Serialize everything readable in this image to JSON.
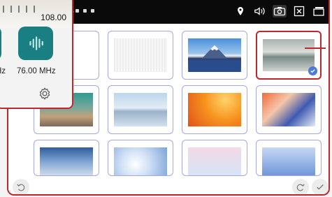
{
  "status": {
    "num": "4"
  },
  "popup": {
    "top_freq": "108.00",
    "main_freq": "76.00 MHz",
    "left_freq_fragment": "Hz"
  },
  "wallpapers": [
    {
      "name": "white"
    },
    {
      "name": "gray-texture"
    },
    {
      "name": "mount-fuji"
    },
    {
      "name": "misty-lake"
    },
    {
      "name": "desert-sunset"
    },
    {
      "name": "salt-flats"
    },
    {
      "name": "orange-waves"
    },
    {
      "name": "abstract-silk"
    },
    {
      "name": "foggy-shore"
    },
    {
      "name": "blue-cloud"
    },
    {
      "name": "soft-gradient"
    },
    {
      "name": "blue-gradient"
    }
  ],
  "colors": {
    "accent": "#c0272d",
    "tile_border": "#a4a9e6",
    "check": "#4f79d8"
  }
}
